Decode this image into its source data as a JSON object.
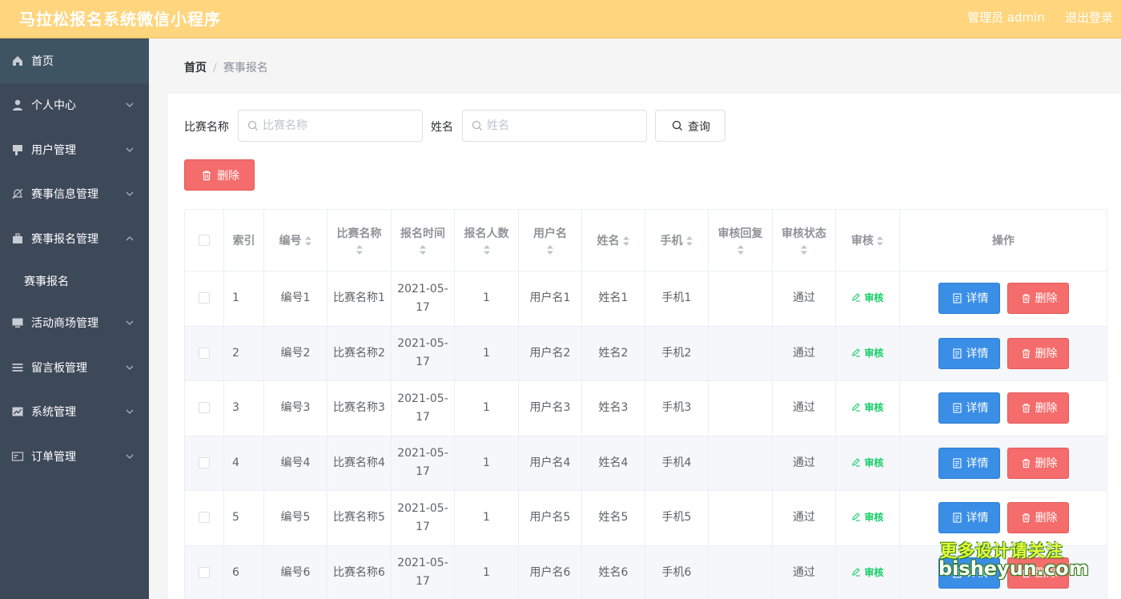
{
  "header": {
    "app_title": "马拉松报名系统微信小程序",
    "admin_label": "管理员 admin",
    "logout_label": "退出登录"
  },
  "sidebar": {
    "items": [
      {
        "label": "首页",
        "icon": "home-icon"
      },
      {
        "label": "个人中心",
        "icon": "user-icon"
      },
      {
        "label": "用户管理",
        "icon": "users-icon"
      },
      {
        "label": "赛事信息管理",
        "icon": "bell-off-icon"
      },
      {
        "label": "赛事报名管理",
        "icon": "briefcase-icon"
      },
      {
        "label": "赛事报名",
        "icon": ""
      },
      {
        "label": "活动商场管理",
        "icon": "monitor-icon"
      },
      {
        "label": "留言板管理",
        "icon": "list-icon"
      },
      {
        "label": "系统管理",
        "icon": "chart-icon"
      },
      {
        "label": "订单管理",
        "icon": "card-icon"
      }
    ]
  },
  "breadcrumb": {
    "home": "首页",
    "separator": "/",
    "current": "赛事报名"
  },
  "search": {
    "race_label": "比赛名称",
    "race_placeholder": "比赛名称",
    "name_label": "姓名",
    "name_placeholder": "姓名",
    "query_label": "查询"
  },
  "actions": {
    "bulk_delete": "删除"
  },
  "table": {
    "columns": [
      "索引",
      "编号",
      "比赛名称",
      "报名时间",
      "报名人数",
      "用户名",
      "姓名",
      "手机",
      "审核回复",
      "审核状态",
      "审核",
      "操作"
    ],
    "audit_label": "审核",
    "detail_label": "详情",
    "delete_label": "删除",
    "rows": [
      {
        "index": "1",
        "code": "编号1",
        "race": "比赛名称1",
        "date": "2021-05-17",
        "count": "1",
        "username": "用户名1",
        "name": "姓名1",
        "phone": "手机1",
        "reply": "",
        "status": "通过"
      },
      {
        "index": "2",
        "code": "编号2",
        "race": "比赛名称2",
        "date": "2021-05-17",
        "count": "1",
        "username": "用户名2",
        "name": "姓名2",
        "phone": "手机2",
        "reply": "",
        "status": "通过"
      },
      {
        "index": "3",
        "code": "编号3",
        "race": "比赛名称3",
        "date": "2021-05-17",
        "count": "1",
        "username": "用户名3",
        "name": "姓名3",
        "phone": "手机3",
        "reply": "",
        "status": "通过"
      },
      {
        "index": "4",
        "code": "编号4",
        "race": "比赛名称4",
        "date": "2021-05-17",
        "count": "1",
        "username": "用户名4",
        "name": "姓名4",
        "phone": "手机4",
        "reply": "",
        "status": "通过"
      },
      {
        "index": "5",
        "code": "编号5",
        "race": "比赛名称5",
        "date": "2021-05-17",
        "count": "1",
        "username": "用户名5",
        "name": "姓名5",
        "phone": "手机5",
        "reply": "",
        "status": "通过"
      },
      {
        "index": "6",
        "code": "编号6",
        "race": "比赛名称6",
        "date": "2021-05-17",
        "count": "1",
        "username": "用户名6",
        "name": "姓名6",
        "phone": "手机6",
        "reply": "",
        "status": "通过"
      }
    ]
  },
  "watermark": {
    "line1": "更多设计请关注",
    "line2": "bisheyun.com"
  },
  "colors": {
    "header_bg": "#ffd57e",
    "sidebar_bg": "#3d4859",
    "danger": "#f56c6c",
    "primary": "#3a8ee6",
    "success": "#13ce66"
  }
}
